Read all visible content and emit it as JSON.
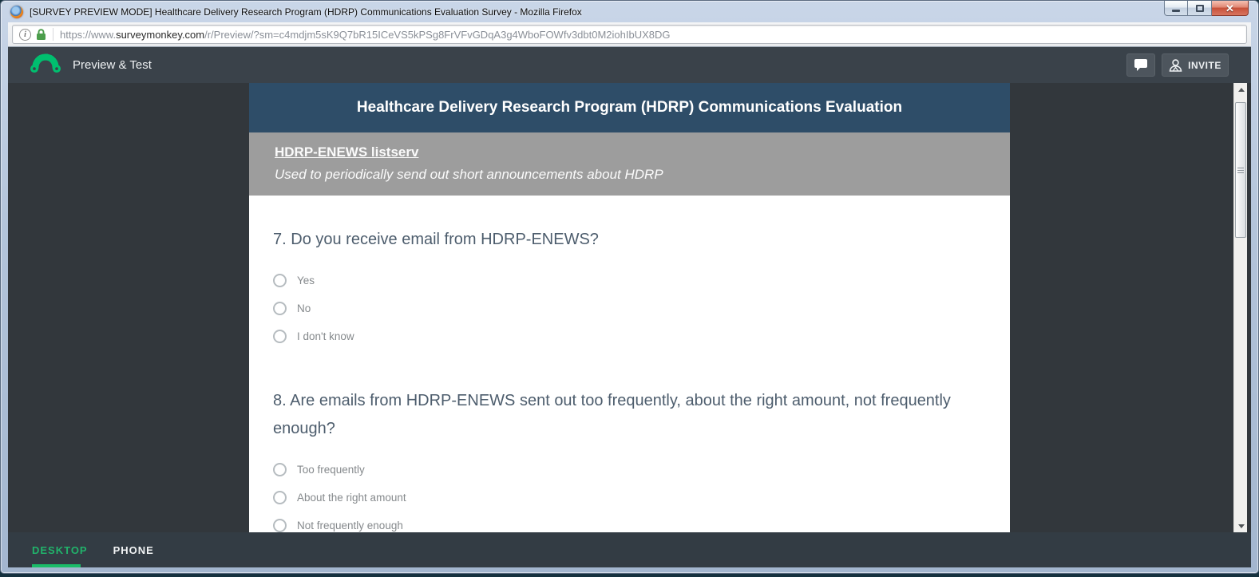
{
  "browser": {
    "window_title": "[SURVEY PREVIEW MODE] Healthcare Delivery Research Program (HDRP) Communications Evaluation Survey - Mozilla Firefox",
    "url": {
      "prefix": "https://www.",
      "domain": "surveymonkey.com",
      "path": "/r/Preview/?sm=c4mdjm5sK9Q7bR15ICeVS5kPSg8FrVFvGDqA3g4WboFOWfv3dbt0M2iohIbUX8DG"
    }
  },
  "app_header": {
    "product_label": "Preview & Test",
    "invite_label": "INVITE"
  },
  "survey": {
    "title": "Healthcare Delivery Research Program (HDRP) Communications Evaluation",
    "section": {
      "heading": "HDRP-ENEWS listserv",
      "description": "Used to periodically send out short announcements about HDRP"
    },
    "questions": [
      {
        "number": "7.",
        "text": "Do you receive email from HDRP-ENEWS?",
        "options": [
          "Yes",
          "No",
          "I don't know"
        ]
      },
      {
        "number": "8.",
        "text": "Are emails from HDRP-ENEWS sent out too frequently, about the right amount, not frequently enough?",
        "options": [
          "Too frequently",
          "About the right amount",
          "Not frequently enough"
        ]
      }
    ]
  },
  "footer_tabs": {
    "desktop": "DESKTOP",
    "phone": "PHONE"
  },
  "colors": {
    "brand_green": "#00bf6f",
    "survey_title_bg": "#2e4d68",
    "section_bg": "#9d9d9d",
    "header_bg": "#3a424a",
    "content_bg": "#32373c",
    "question_text": "#4d5d6d"
  }
}
